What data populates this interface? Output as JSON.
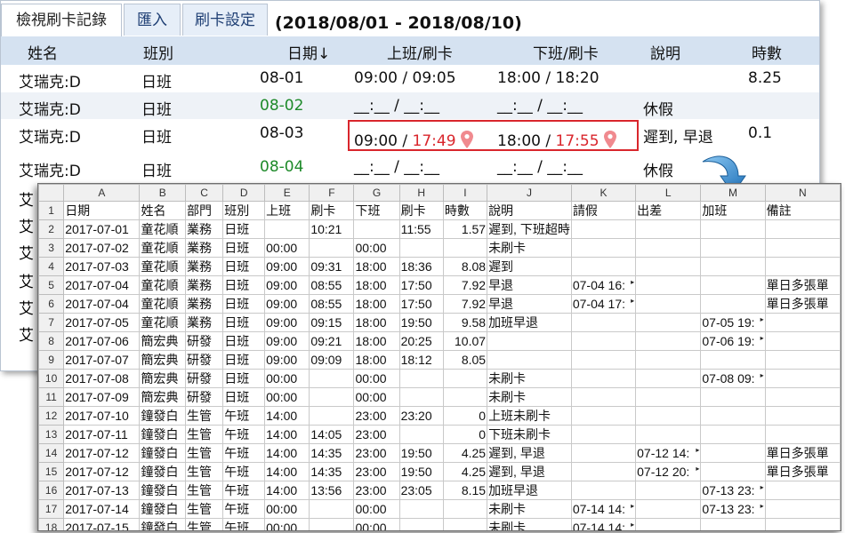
{
  "tabs": [
    {
      "label": "檢視刷卡記錄",
      "active": true
    },
    {
      "label": "匯入",
      "active": false
    },
    {
      "label": "刷卡設定",
      "active": false
    }
  ],
  "date_range": "(2018/08/01 - 2018/08/10)",
  "columns": [
    "姓名",
    "班別",
    "日期↓",
    "上班/刷卡",
    "下班/刷卡",
    "說明",
    "時數"
  ],
  "rows": [
    {
      "name": "艾瑞克:D",
      "shift": "日班",
      "date": "08-01",
      "in_sched": "09:00",
      "in_punch": "09:05",
      "out_sched": "18:00",
      "out_punch": "18:20",
      "note": "",
      "hours": "8.25"
    },
    {
      "name": "艾瑞克:D",
      "shift": "日班",
      "date": "08-02",
      "in_sched": "__:__",
      "in_punch": "__:__",
      "out_sched": "__:__",
      "out_punch": "__:__",
      "note": "休假",
      "hours": ""
    },
    {
      "name": "艾瑞克:D",
      "shift": "日班",
      "date": "08-03",
      "in_sched": "09:00",
      "in_punch": "17:49",
      "out_sched": "18:00",
      "out_punch": "17:55",
      "note": "遲到, 早退",
      "hours": "0.1"
    },
    {
      "name": "艾瑞克:D",
      "shift": "日班",
      "date": "08-04",
      "in_sched": "__:__",
      "in_punch": "__:__",
      "out_sched": "__:__",
      "out_punch": "__:__",
      "note": "休假",
      "hours": ""
    }
  ],
  "hidden_row_names": [
    "艾",
    "艾",
    "艾",
    "艾",
    "艾",
    "艾"
  ],
  "sheet": {
    "col_letters": [
      "A",
      "B",
      "C",
      "D",
      "E",
      "F",
      "G",
      "H",
      "I",
      "J",
      "K",
      "L",
      "M",
      "N"
    ],
    "rows": [
      [
        "日期",
        "姓名",
        "部門",
        "班別",
        "上班",
        "刷卡",
        "下班",
        "刷卡",
        "時數",
        "說明",
        "請假",
        "出差",
        "加班",
        "備註"
      ],
      [
        "2017-07-01",
        "童花順",
        "業務",
        "日班",
        "",
        "10:21",
        "",
        "11:55",
        "1.57",
        "遲到, 下班超時",
        "",
        "",
        "",
        ""
      ],
      [
        "2017-07-02",
        "童花順",
        "業務",
        "日班",
        "00:00",
        "",
        "00:00",
        "",
        "",
        "未刷卡",
        "",
        "",
        "",
        ""
      ],
      [
        "2017-07-03",
        "童花順",
        "業務",
        "日班",
        "09:00",
        "09:31",
        "18:00",
        "18:36",
        "8.08",
        "遲到",
        "",
        "",
        "",
        ""
      ],
      [
        "2017-07-04",
        "童花順",
        "業務",
        "日班",
        "09:00",
        "08:55",
        "18:00",
        "17:50",
        "7.92",
        "早退",
        "07-04 16:",
        "",
        "",
        "單日多張單"
      ],
      [
        "2017-07-04",
        "童花順",
        "業務",
        "日班",
        "09:00",
        "08:55",
        "18:00",
        "17:50",
        "7.92",
        "早退",
        "07-04 17:",
        "",
        "",
        "單日多張單"
      ],
      [
        "2017-07-05",
        "童花順",
        "業務",
        "日班",
        "09:00",
        "09:15",
        "18:00",
        "19:50",
        "9.58",
        "加班早退",
        "",
        "",
        "07-05 19:",
        ""
      ],
      [
        "2017-07-06",
        "簡宏典",
        "研發",
        "日班",
        "09:00",
        "09:21",
        "18:00",
        "20:25",
        "10.07",
        "",
        "",
        "",
        "07-06 19:",
        ""
      ],
      [
        "2017-07-07",
        "簡宏典",
        "研發",
        "日班",
        "09:00",
        "09:09",
        "18:00",
        "18:12",
        "8.05",
        "",
        "",
        "",
        "",
        ""
      ],
      [
        "2017-07-08",
        "簡宏典",
        "研發",
        "日班",
        "00:00",
        "",
        "00:00",
        "",
        "",
        "未刷卡",
        "",
        "",
        "07-08 09:",
        ""
      ],
      [
        "2017-07-09",
        "簡宏典",
        "研發",
        "日班",
        "00:00",
        "",
        "00:00",
        "",
        "",
        "未刷卡",
        "",
        "",
        "",
        ""
      ],
      [
        "2017-07-10",
        "鐘發白",
        "生管",
        "午班",
        "14:00",
        "",
        "23:00",
        "23:20",
        "0",
        "上班未刷卡",
        "",
        "",
        "",
        ""
      ],
      [
        "2017-07-11",
        "鐘發白",
        "生管",
        "午班",
        "14:00",
        "14:05",
        "23:00",
        "",
        "0",
        "下班未刷卡",
        "",
        "",
        "",
        ""
      ],
      [
        "2017-07-12",
        "鐘發白",
        "生管",
        "午班",
        "14:00",
        "14:35",
        "23:00",
        "19:50",
        "4.25",
        "遲到, 早退",
        "",
        "07-12 14:",
        "",
        "單日多張單"
      ],
      [
        "2017-07-12",
        "鐘發白",
        "生管",
        "午班",
        "14:00",
        "14:35",
        "23:00",
        "19:50",
        "4.25",
        "遲到, 早退",
        "",
        "07-12 20:",
        "",
        "單日多張單"
      ],
      [
        "2017-07-13",
        "鐘發白",
        "生管",
        "午班",
        "14:00",
        "13:56",
        "23:00",
        "23:05",
        "8.15",
        "加班早退",
        "",
        "",
        "07-13 23:",
        ""
      ],
      [
        "2017-07-14",
        "鐘發白",
        "生管",
        "午班",
        "00:00",
        "",
        "00:00",
        "",
        "",
        "未刷卡",
        "07-14 14:",
        "",
        "07-13 23:",
        ""
      ],
      [
        "2017-07-15",
        "鐘發白",
        "生管",
        "午班",
        "00:00",
        "",
        "00:00",
        "",
        "",
        "未刷卡",
        "07-14 14:",
        "",
        "",
        ""
      ]
    ]
  },
  "colors": {
    "late_punch": "#d9262c",
    "leave_date": "#1e8a2a",
    "header_bg": "#d5e2f1",
    "tab_text": "#1f3f74"
  }
}
